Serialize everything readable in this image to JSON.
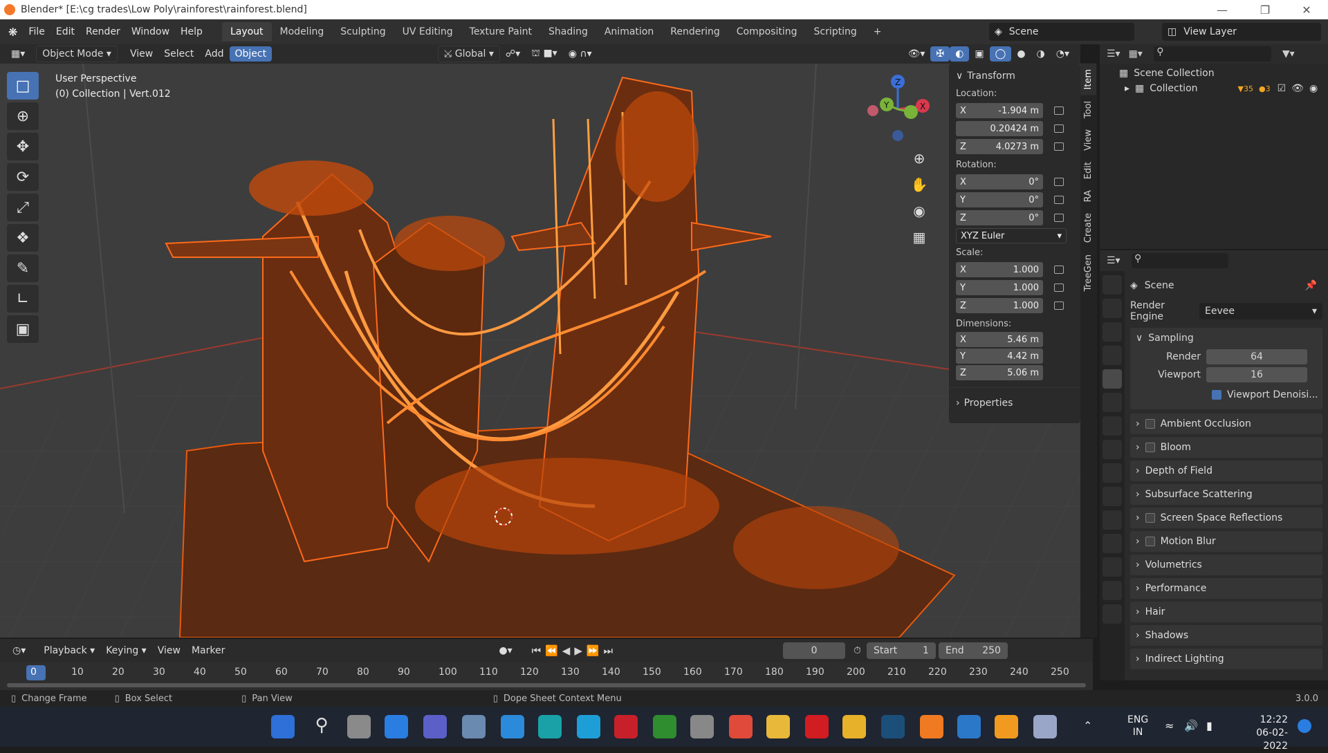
{
  "titlebar": {
    "title": "Blender* [E:\\cg trades\\Low Poly\\rainforest\\rainforest.blend]"
  },
  "menu": {
    "items": [
      "File",
      "Edit",
      "Render",
      "Window",
      "Help"
    ]
  },
  "workspaces": [
    "Layout",
    "Modeling",
    "Sculpting",
    "UV Editing",
    "Texture Paint",
    "Shading",
    "Animation",
    "Rendering",
    "Compositing",
    "Scripting"
  ],
  "scene_field": "Scene",
  "viewlayer_field": "View Layer",
  "viewport_header": {
    "mode": "Object Mode",
    "menus": [
      "View",
      "Select",
      "Add",
      "Object"
    ],
    "orientation": "Global"
  },
  "viewport": {
    "perspective": "User Perspective",
    "collection_info": "(0) Collection | Vert.012",
    "gizmo": {
      "x": "X",
      "y": "Y",
      "z": "Z"
    }
  },
  "npanel": {
    "transform_title": "Transform",
    "location_label": "Location:",
    "location": [
      {
        "axis": "X",
        "value": "-1.904 m"
      },
      {
        "axis": "",
        "value": "0.20424 m"
      },
      {
        "axis": "Z",
        "value": "4.0273 m"
      }
    ],
    "rotation_label": "Rotation:",
    "rotation": [
      {
        "axis": "X",
        "value": "0°"
      },
      {
        "axis": "Y",
        "value": "0°"
      },
      {
        "axis": "Z",
        "value": "0°"
      }
    ],
    "rotation_mode": "XYZ Euler",
    "scale_label": "Scale:",
    "scale": [
      {
        "axis": "X",
        "value": "1.000"
      },
      {
        "axis": "Y",
        "value": "1.000"
      },
      {
        "axis": "Z",
        "value": "1.000"
      }
    ],
    "dimensions_label": "Dimensions:",
    "dimensions": [
      {
        "axis": "X",
        "value": "5.46 m"
      },
      {
        "axis": "Y",
        "value": "4.42 m"
      },
      {
        "axis": "Z",
        "value": "5.06 m"
      }
    ],
    "properties_label": "Properties",
    "tabs": [
      "Item",
      "Tool",
      "View",
      "Edit",
      "RA",
      "Create",
      "TreeGen"
    ]
  },
  "outliner": {
    "scene_collection": "Scene Collection",
    "collection": "Collection",
    "badge_a": "35",
    "badge_b": "3"
  },
  "properties": {
    "context": "Scene",
    "render_engine_label": "Render Engine",
    "render_engine": "Eevee",
    "sampling_label": "Sampling",
    "render_label": "Render",
    "render_value": "64",
    "viewport_label": "Viewport",
    "viewport_value": "16",
    "viewport_denoise": "Viewport Denoisi...",
    "panels": [
      {
        "label": "Ambient Occlusion",
        "checkbox": true
      },
      {
        "label": "Bloom",
        "checkbox": true
      },
      {
        "label": "Depth of Field",
        "checkbox": false
      },
      {
        "label": "Subsurface Scattering",
        "checkbox": false
      },
      {
        "label": "Screen Space Reflections",
        "checkbox": true
      },
      {
        "label": "Motion Blur",
        "checkbox": true
      },
      {
        "label": "Volumetrics",
        "checkbox": false
      },
      {
        "label": "Performance",
        "checkbox": false
      },
      {
        "label": "Hair",
        "checkbox": false
      },
      {
        "label": "Shadows",
        "checkbox": false
      },
      {
        "label": "Indirect Lighting",
        "checkbox": false
      }
    ]
  },
  "timeline": {
    "menus": [
      "Playback",
      "Keying",
      "View",
      "Marker"
    ],
    "current_frame": "0",
    "start_label": "Start",
    "start": "1",
    "end_label": "End",
    "end": "250",
    "ticks": [
      "0",
      "10",
      "20",
      "30",
      "40",
      "50",
      "60",
      "70",
      "80",
      "90",
      "100",
      "110",
      "120",
      "130",
      "140",
      "150",
      "160",
      "170",
      "180",
      "190",
      "200",
      "210",
      "220",
      "230",
      "240",
      "250"
    ]
  },
  "statusbar": {
    "change_frame": "Change Frame",
    "box_select": "Box Select",
    "pan_view": "Pan View",
    "context_menu": "Dope Sheet Context Menu",
    "version": "3.0.0"
  },
  "taskbar": {
    "lang_1": "ENG",
    "lang_2": "IN",
    "time": "12:22",
    "date": "06-02-2022"
  },
  "colors": {
    "accent": "#4772b3",
    "wire": "#e85a0c",
    "blender_orange": "#f5792a"
  }
}
